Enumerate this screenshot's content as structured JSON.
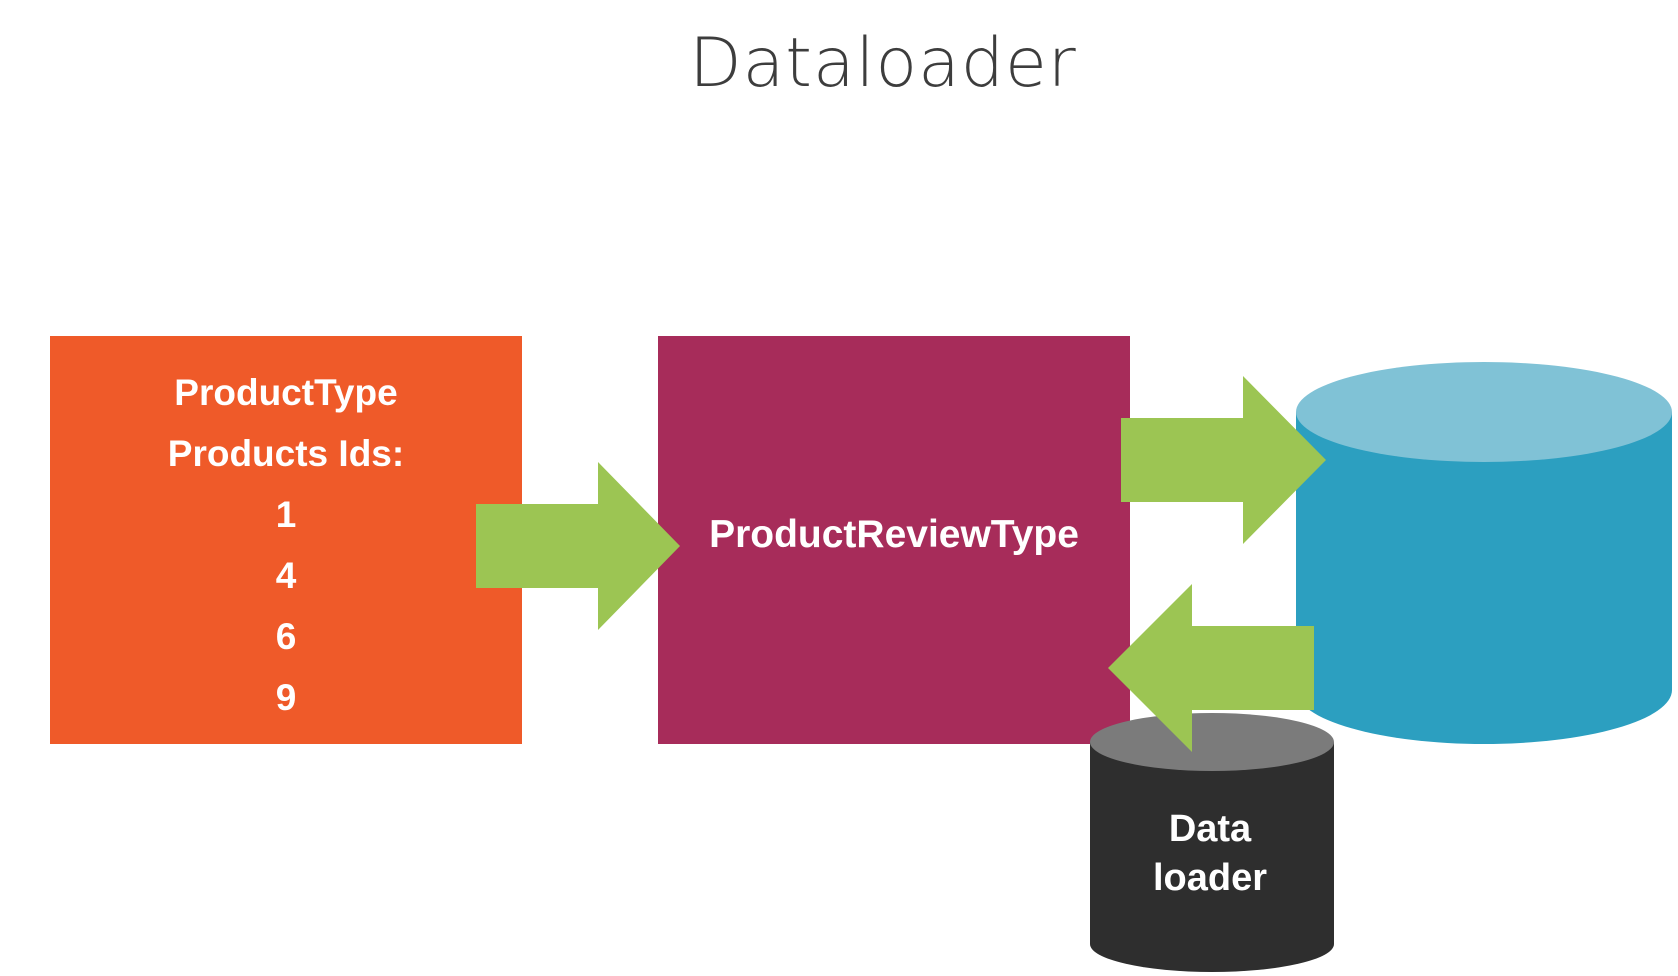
{
  "title": "Dataloader",
  "product_type": {
    "name": "ProductType",
    "ids_label": "Products Ids:",
    "ids": [
      "1",
      "4",
      "6",
      "9"
    ]
  },
  "product_review_type": {
    "name": "ProductReviewType"
  },
  "dataloader": {
    "line1": "Data",
    "line2": "loader"
  },
  "colors": {
    "product_type_box": "#ef5a29",
    "product_review_box": "#a72c5a",
    "arrow": "#9cc553",
    "database_top": "#80c2d6",
    "database_body": "#2c9fc0",
    "dataloader_top": "#7b7b7b",
    "dataloader_body": "#2e2e2e"
  },
  "icons": [
    "right-arrow-icon",
    "left-arrow-icon",
    "database-icon",
    "dataloader-cylinder-icon"
  ]
}
